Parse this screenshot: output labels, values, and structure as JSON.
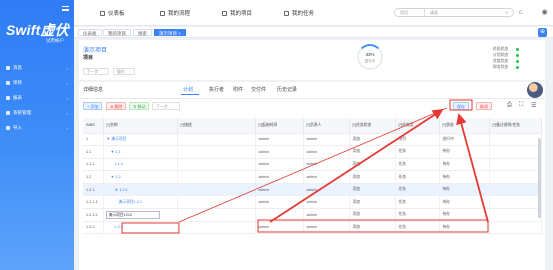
{
  "sidebar": {
    "logo": "Swift虚伏",
    "logo_sub": "试用帐户",
    "items": [
      {
        "label": "消息",
        "icon": "message-icon"
      },
      {
        "label": "项目",
        "icon": "project-icon"
      },
      {
        "label": "报表",
        "icon": "report-icon"
      },
      {
        "label": "系统管理",
        "icon": "settings-icon"
      },
      {
        "label": "导入",
        "icon": "import-icon"
      }
    ]
  },
  "topbar": {
    "menus": [
      {
        "label": "仪表板",
        "icon": "dashboard-icon"
      },
      {
        "label": "我的流程",
        "icon": "flow-icon"
      },
      {
        "label": "我的项目",
        "icon": "folder-icon"
      },
      {
        "label": "我的任务",
        "icon": "task-icon"
      }
    ],
    "search_select": "项目",
    "search_placeholder": "请选",
    "search_icon": "search-icon"
  },
  "tabs": [
    {
      "label": "仪表板"
    },
    {
      "label": "我的项目"
    },
    {
      "label": "搜索"
    },
    {
      "label": "演示项目 ×",
      "active": true
    }
  ],
  "project": {
    "name": "演示项目",
    "subtitle": "项目",
    "select1": "下一步",
    "select2": "操作",
    "progress_value": "33%",
    "progress_label": "进行中",
    "progress_fraction": 0.33,
    "stats": [
      {
        "label": "阶段状态"
      },
      {
        "label": "计划状态"
      },
      {
        "label": "进度状态"
      },
      {
        "label": "财务状态"
      }
    ]
  },
  "subtabs": [
    "详细信息",
    "计划",
    "执行者",
    "附件",
    "交付件",
    "历史记录"
  ],
  "toolbar": {
    "add": "+ 添加",
    "delete": "⊗ 删除",
    "move": "⇅ 移动",
    "select_placeholder": "下一步",
    "save": "保存",
    "cancel": "取消"
  },
  "table": {
    "headers": [
      "WBS",
      "[*]名称",
      "[*]描述",
      "[*]起始时间",
      "[*]负责人",
      "[*]任务状态",
      "[*]任务类",
      "[*]状态",
      "[*]备注说明/任务"
    ],
    "rows": [
      {
        "wbs": "1",
        "name": "▼ 演示项目",
        "desc": "",
        "start": "",
        "owner": "admin",
        "c5": "admin",
        "c6": "添加",
        "c7": "项目",
        "c8": "进行中",
        "c9": ""
      },
      {
        "wbs": "1.1",
        "name": "▼ 1.1",
        "desc": "",
        "start": "",
        "owner": "admin",
        "c5": "admin",
        "c6": "添加",
        "c7": "任务",
        "c8": "待办",
        "c9": ""
      },
      {
        "wbs": "1.1.1",
        "name": "1.1.1",
        "desc": "",
        "start": "",
        "owner": "admin",
        "c5": "admin",
        "c6": "添加",
        "c7": "任务",
        "c8": "待办",
        "c9": ""
      },
      {
        "wbs": "1.2",
        "name": "▼ 1.2",
        "desc": "",
        "start": "",
        "owner": "admin",
        "c5": "admin",
        "c6": "添加",
        "c7": "任务",
        "c8": "待办",
        "c9": ""
      },
      {
        "wbs": "1.2.1",
        "name": "▼ 1.2.1",
        "desc": "",
        "start": "",
        "owner": "admin",
        "c5": "admin",
        "c6": "添加",
        "c7": "任务",
        "c8": "待办",
        "c9": ""
      },
      {
        "wbs": "1.2.1.1",
        "name": "演示项目1.2.1",
        "desc": "",
        "start": "",
        "owner": "admin",
        "c5": "admin",
        "c6": "添加",
        "c7": "任务",
        "c8": "待办",
        "c9": ""
      },
      {
        "wbs": "1.2.1.2",
        "name": "演示项目1212",
        "desc": "",
        "start": "",
        "owner": "",
        "c5": "admin",
        "c6": "添加",
        "c7": "任务",
        "c8": "待办",
        "c9": ""
      },
      {
        "wbs": "1.2.2",
        "name": "1.2.2",
        "desc": "",
        "start": "",
        "owner": "admin",
        "c5": "admin",
        "c6": "添加",
        "c7": "任务",
        "c8": "待办",
        "c9": ""
      }
    ]
  },
  "colors": {
    "primary": "#3b82f6",
    "annotation": "#e53935",
    "sidebar_top": "#2f7cf6",
    "sidebar_bottom": "#5da3fb"
  }
}
